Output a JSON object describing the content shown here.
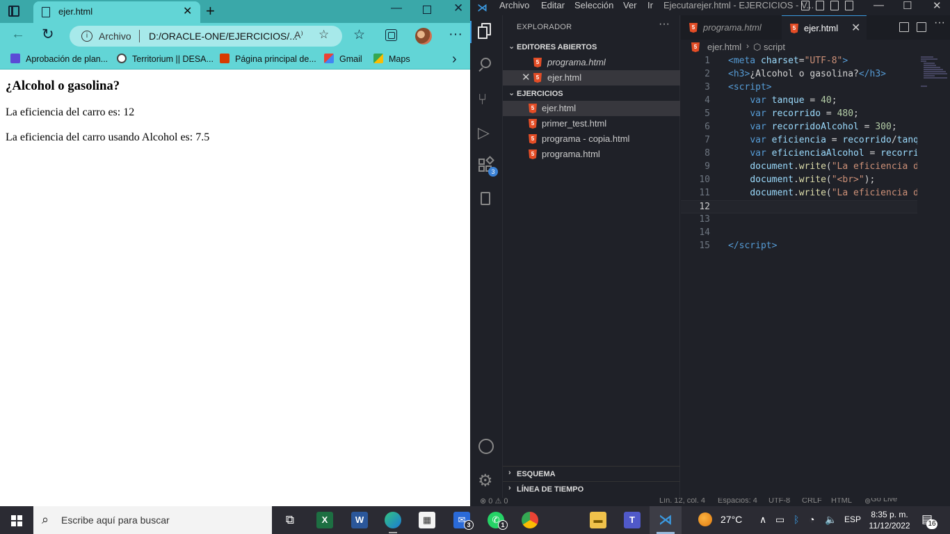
{
  "browser": {
    "tab_title": "ejer.html",
    "address_label": "Archivo",
    "url": "D:/ORACLE-ONE/EJERCICIOS/...",
    "favorites": [
      {
        "label": "Aprobación de plan...",
        "icon": "list-icon",
        "color": "#5b4bd6"
      },
      {
        "label": "Territorium || DESA...",
        "icon": "eye-icon",
        "color": "#444"
      },
      {
        "label": "Página principal de...",
        "icon": "office-icon",
        "color": "#d83b01"
      },
      {
        "label": "Gmail",
        "icon": "gmail-icon",
        "color": "#ea4335"
      },
      {
        "label": "Maps",
        "icon": "maps-icon",
        "color": "#34a853"
      }
    ],
    "page": {
      "heading": "¿Alcohol o gasolina?",
      "line1": "La eficiencia del carro es: 12",
      "line2": "La eficiencia del carro usando Alcohol es: 7.5"
    }
  },
  "vscode": {
    "menu": [
      "Archivo",
      "Editar",
      "Selección",
      "Ver",
      "Ir"
    ],
    "title": "Ejecutarejer.html - EJERCICIOS - V...",
    "explorer_title": "EXPLORADOR",
    "open_editors_title": "EDITORES ABIERTOS",
    "open_editors": [
      "programa.html",
      "ejer.html"
    ],
    "folder_title": "EJERCICIOS",
    "files": [
      "ejer.html",
      "primer_test.html",
      "programa - copia.html",
      "programa.html"
    ],
    "outline_title": "ESQUEMA",
    "timeline_title": "LÍNEA DE TIEMPO",
    "extensions_badge": "3",
    "tabs": [
      "programa.html",
      "ejer.html"
    ],
    "breadcrumb": {
      "file": "ejer.html",
      "symbol": "script"
    },
    "code_lines": [
      {
        "n": "1",
        "html": "<span class='tg'>&lt;meta</span> <span class='at'>charset</span>=<span class='st'>\"UTF-8\"</span><span class='tg'>&gt;</span>"
      },
      {
        "n": "2",
        "html": "<span class='tg'>&lt;h3&gt;</span>¿Alcohol o gasolina?<span class='tg'>&lt;/h3&gt;</span>"
      },
      {
        "n": "3",
        "html": "<span class='tg'>&lt;script&gt;</span>"
      },
      {
        "n": "4",
        "html": "    <span class='kw'>var</span> <span class='vr'>tanque</span> = <span class='nm2'>40</span>;"
      },
      {
        "n": "5",
        "html": "    <span class='kw'>var</span> <span class='vr'>recorrido</span> = <span class='nm2'>480</span>;"
      },
      {
        "n": "6",
        "html": "    <span class='kw'>var</span> <span class='vr'>recorridoAlcohol</span> = <span class='nm2'>300</span>;"
      },
      {
        "n": "7",
        "html": "    <span class='kw'>var</span> <span class='vr'>eficiencia</span> = <span class='vr'>recorrido</span>/<span class='vr'>tanque</span>;"
      },
      {
        "n": "8",
        "html": "    <span class='kw'>var</span> <span class='vr'>eficienciaAlcohol</span> = <span class='vr'>recorridoAlcohol</span>/<span class='vr'>tanque</span>;"
      },
      {
        "n": "9",
        "html": "    <span class='vr'>document</span>.<span class='fn'>write</span>(<span class='st'>\"La eficiencia del carro es: \"</span>);"
      },
      {
        "n": "10",
        "html": "    <span class='vr'>document</span>.<span class='fn'>write</span>(<span class='st'>\"&lt;br&gt;\"</span>);"
      },
      {
        "n": "11",
        "html": "    <span class='vr'>document</span>.<span class='fn'>write</span>(<span class='st'>\"La eficiencia del carro usando Alcohol\"</span>);"
      },
      {
        "n": "12",
        "html": ""
      },
      {
        "n": "13",
        "html": ""
      },
      {
        "n": "14",
        "html": ""
      },
      {
        "n": "15",
        "html": "<span class='tg'>&lt;/script&gt;</span>"
      }
    ],
    "status": {
      "problems": "⊗ 0 ⚠ 0",
      "position": "Lín. 12, col. 4",
      "spaces": "Espacios: 4",
      "encoding": "UTF-8",
      "eol": "CRLF",
      "language": "HTML",
      "golive": "Go Live"
    }
  },
  "taskbar": {
    "search_placeholder": "Escribe aquí para buscar",
    "weather": "27°C",
    "lang": "ESP",
    "time": "8:35 p. m.",
    "date": "11/12/2022",
    "notifications": "16",
    "mail_badge": "3",
    "whatsapp_badge": "1"
  }
}
